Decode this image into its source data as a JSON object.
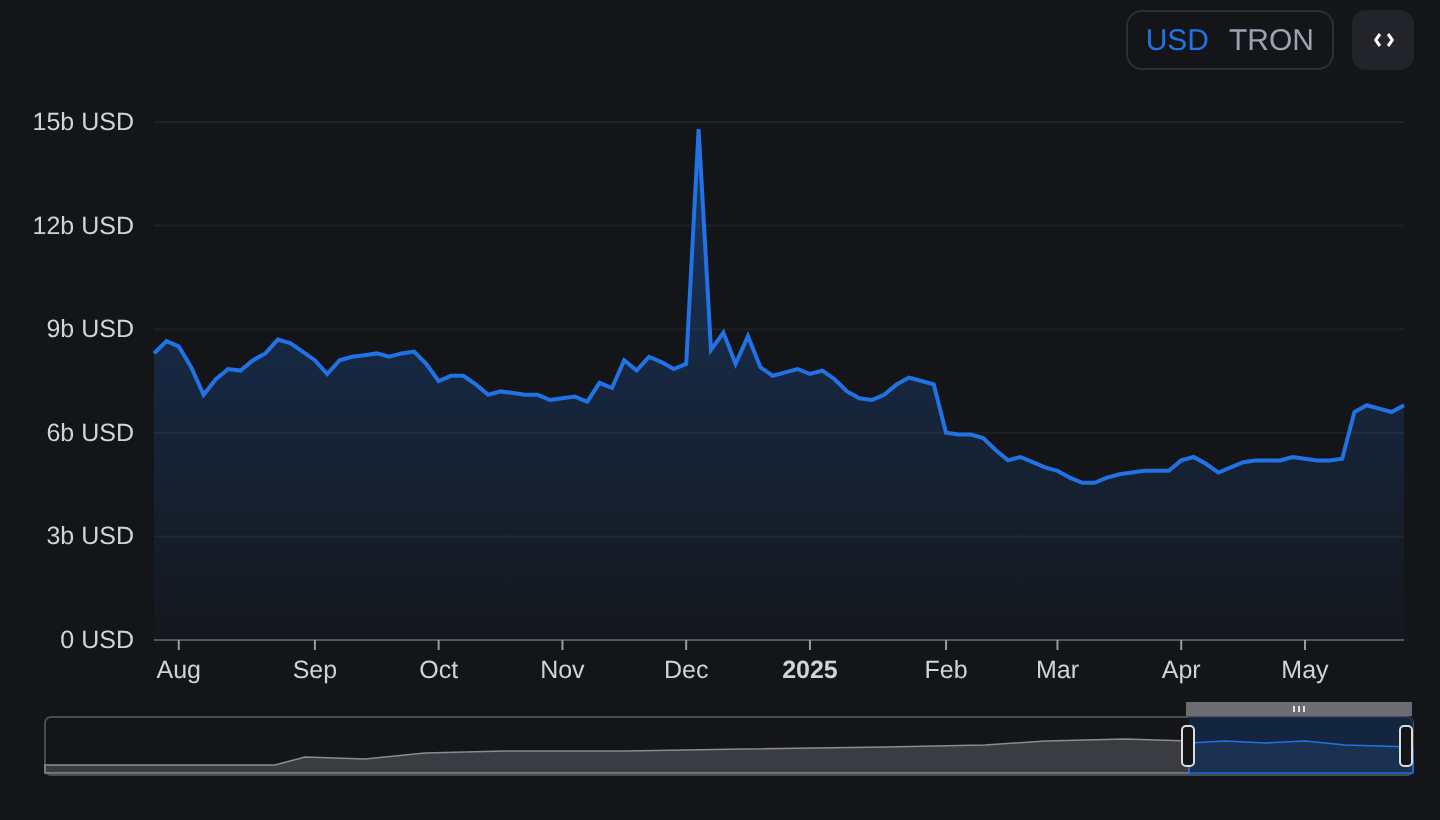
{
  "toolbar": {
    "currency_options": [
      {
        "label": "USD",
        "selected": true
      },
      {
        "label": "TRON",
        "selected": false
      }
    ]
  },
  "chart": {
    "chart_data": {
      "type": "area",
      "categories": [
        null,
        null,
        "Aug",
        null,
        null,
        null,
        null,
        null,
        null,
        null,
        null,
        null,
        null,
        "Sep",
        null,
        null,
        null,
        null,
        null,
        null,
        null,
        null,
        null,
        "Oct",
        null,
        null,
        null,
        null,
        null,
        null,
        null,
        null,
        null,
        "Nov",
        null,
        null,
        null,
        null,
        null,
        null,
        null,
        null,
        null,
        "Dec",
        null,
        null,
        null,
        null,
        null,
        null,
        null,
        null,
        null,
        "2025",
        null,
        null,
        null,
        null,
        null,
        null,
        null,
        null,
        null,
        null,
        "Feb",
        null,
        null,
        null,
        null,
        null,
        null,
        null,
        null,
        "Mar",
        null,
        null,
        null,
        null,
        null,
        null,
        null,
        null,
        null,
        "Apr",
        null,
        null,
        null,
        null,
        null,
        null,
        null,
        null,
        null,
        "May",
        null,
        null,
        null,
        null,
        null,
        null,
        null,
        null
      ],
      "series": [
        {
          "color": "#2172e5",
          "values": [
            8.3,
            8.65,
            8.5,
            7.9,
            7.1,
            7.55,
            7.85,
            7.8,
            8.1,
            8.3,
            8.7,
            8.6,
            8.35,
            8.1,
            7.7,
            8.1,
            8.2,
            8.25,
            8.3,
            8.2,
            8.3,
            8.35,
            8.0,
            7.5,
            7.65,
            7.65,
            7.4,
            7.1,
            7.2,
            7.15,
            7.1,
            7.1,
            6.95,
            7.0,
            7.05,
            6.9,
            7.45,
            7.3,
            8.1,
            7.8,
            8.2,
            8.05,
            7.85,
            8.0,
            14.8,
            8.4,
            8.9,
            8.0,
            8.8,
            7.9,
            7.65,
            7.75,
            7.85,
            7.7,
            7.8,
            7.55,
            7.2,
            7.0,
            6.95,
            7.1,
            7.4,
            7.6,
            7.5,
            7.4,
            6.0,
            5.95,
            5.95,
            5.85,
            5.5,
            5.2,
            5.3,
            5.15,
            5.0,
            4.9,
            4.7,
            4.55,
            4.55,
            4.7,
            4.8,
            4.85,
            4.9,
            4.9,
            4.9,
            5.2,
            5.3,
            5.1,
            4.85,
            5.0,
            5.15,
            5.2,
            5.2,
            5.2,
            5.3,
            5.25,
            5.2,
            5.2,
            5.25,
            6.6,
            6.8,
            6.7,
            6.6,
            6.8
          ]
        }
      ],
      "ylim": [
        0,
        15
      ],
      "grid": true,
      "yticks": [
        {
          "value": 0,
          "label": "0 USD"
        },
        {
          "value": 3,
          "label": "3b USD"
        },
        {
          "value": 6,
          "label": "6b USD"
        },
        {
          "value": 9,
          "label": "9b USD"
        },
        {
          "value": 12,
          "label": "12b USD"
        },
        {
          "value": 15,
          "label": "15b USD"
        }
      ]
    }
  }
}
